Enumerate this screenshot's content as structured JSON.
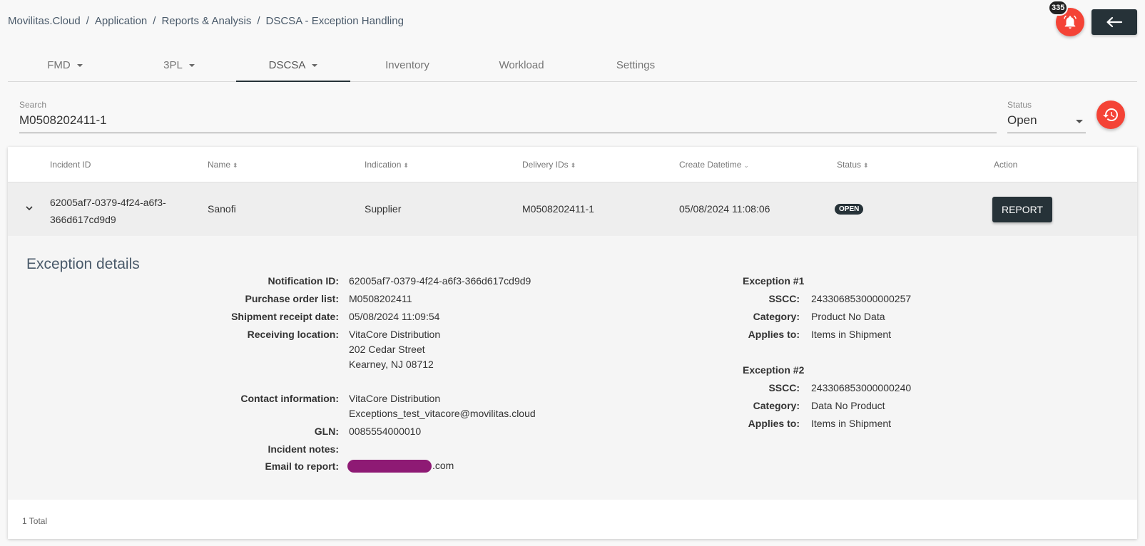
{
  "breadcrumb": [
    "Movilitas.Cloud",
    "Application",
    "Reports & Analysis",
    "DSCSA - Exception Handling"
  ],
  "notifications": {
    "count": "335"
  },
  "tabs": [
    {
      "label": "FMD",
      "dropdown": true
    },
    {
      "label": "3PL",
      "dropdown": true
    },
    {
      "label": "DSCSA",
      "dropdown": true,
      "active": true
    },
    {
      "label": "Inventory"
    },
    {
      "label": "Workload"
    },
    {
      "label": "Settings"
    }
  ],
  "search": {
    "label": "Search",
    "value": "M0508202411-1"
  },
  "status_filter": {
    "label": "Status",
    "value": "Open"
  },
  "table": {
    "columns": [
      "Incident ID",
      "Name",
      "Indication",
      "Delivery IDs",
      "Create Datetime",
      "Status",
      "Action"
    ],
    "rows": [
      {
        "incident_id_line1": "62005af7-0379-4f24-a6f3-",
        "incident_id_line2": "366d617cd9d9",
        "name": "Sanofi",
        "indication": "Supplier",
        "delivery_ids": "M0508202411-1",
        "create_datetime": "05/08/2024 11:08:06",
        "status": "OPEN",
        "action": "REPORT"
      }
    ],
    "total": "1 Total"
  },
  "details": {
    "title": "Exception details",
    "left": {
      "notification_id": {
        "k": "Notification ID:",
        "v": "62005af7-0379-4f24-a6f3-366d617cd9d9"
      },
      "po_list": {
        "k": "Purchase order list:",
        "v": "M0508202411"
      },
      "receipt_date": {
        "k": "Shipment receipt date:",
        "v": "05/08/2024 11:09:54"
      },
      "receiving_location": {
        "k": "Receiving location:",
        "v1": "VitaCore Distribution",
        "v2": "202 Cedar Street",
        "v3": "Kearney, NJ 08712"
      },
      "contact": {
        "k": "Contact information:",
        "v1": "VitaCore Distribution",
        "v2": "Exceptions_test_vitacore@movilitas.cloud"
      },
      "gln": {
        "k": "GLN:",
        "v": "0085554000010"
      },
      "incident_notes": {
        "k": "Incident notes:",
        "v": ""
      },
      "email_report": {
        "k": "Email to report:",
        "v": ".com"
      }
    },
    "exceptions": [
      {
        "title": "Exception #1",
        "sscc_k": "SSCC:",
        "sscc": "243306853000000257",
        "category_k": "Category:",
        "category": "Product No Data",
        "applies_k": "Applies to:",
        "applies": "Items in Shipment"
      },
      {
        "title": "Exception #2",
        "sscc_k": "SSCC:",
        "sscc": "243306853000000240",
        "category_k": "Category:",
        "category": "Data No Product",
        "applies_k": "Applies to:",
        "applies": "Items in Shipment"
      }
    ]
  },
  "colors": {
    "accent_red": "#f44336",
    "dark": "#263238",
    "redaction": "#8e1a74"
  }
}
